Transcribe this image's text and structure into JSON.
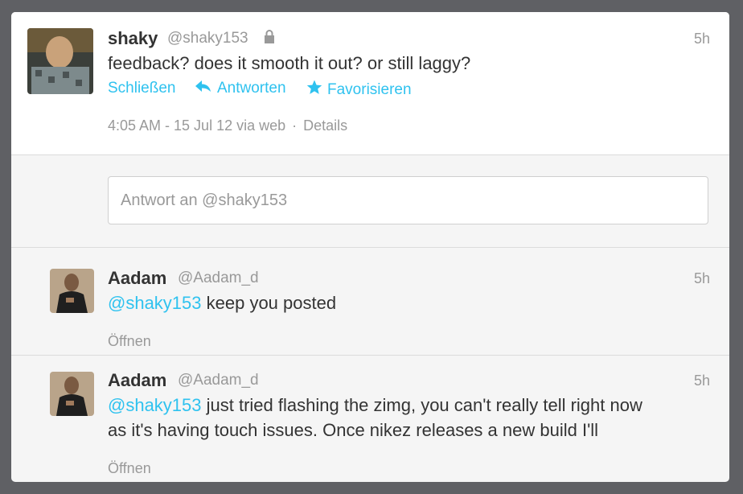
{
  "main_tweet": {
    "name": "shaky",
    "handle": "@shaky153",
    "time": "5h",
    "text": "feedback? does it smooth it out? or still laggy?",
    "actions": {
      "close": "Schließen",
      "reply": "Antworten",
      "favorite": "Favorisieren"
    },
    "meta": {
      "timestamp": "4:05 AM - 15 Jul 12 via web",
      "separator": "·",
      "details": "Details"
    }
  },
  "reply_box": {
    "placeholder": "Antwort an @shaky153"
  },
  "replies": [
    {
      "name": "Aadam",
      "handle": "@Aadam_d",
      "time": "5h",
      "mention": "@shaky153",
      "text": " keep you posted",
      "open": "Öffnen"
    },
    {
      "name": "Aadam",
      "handle": "@Aadam_d",
      "time": "5h",
      "mention": "@shaky153",
      "text_line1": " just tried flashing the zimg, you can't really tell right now",
      "text_line2": "as it's having touch issues. Once nikez releases a new build I'll",
      "open": "Öffnen"
    }
  ],
  "colors": {
    "link": "#2fc2ef",
    "muted": "#999999",
    "text": "#333333"
  }
}
